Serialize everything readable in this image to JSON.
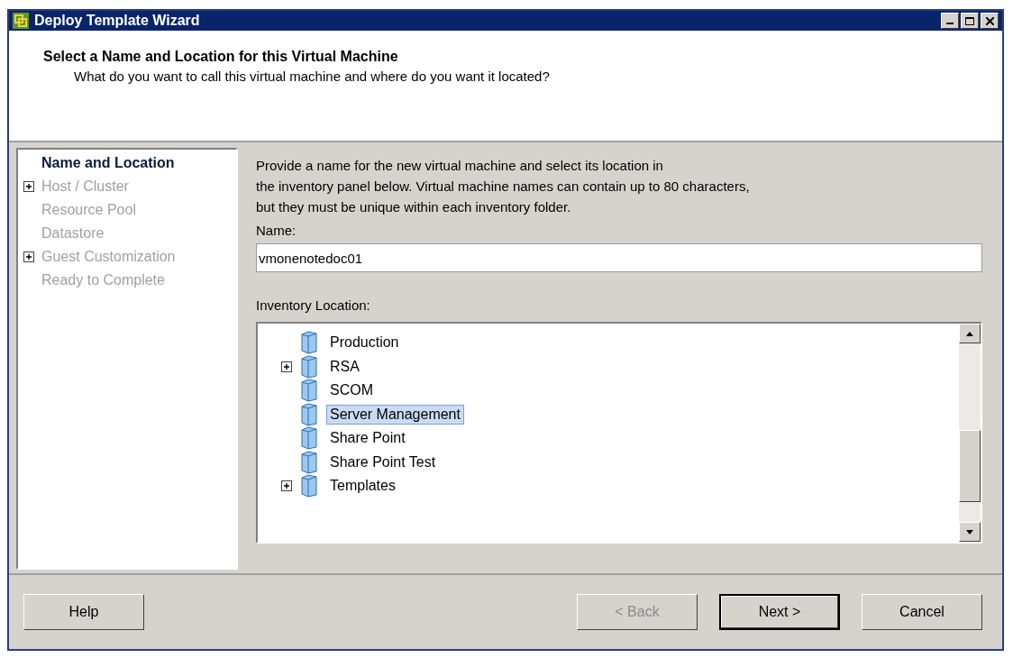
{
  "window": {
    "title": "Deploy Template Wizard"
  },
  "header": {
    "title": "Select a Name and Location for this Virtual Machine",
    "subtitle": "What do you want to call this virtual machine and where do you want it located?"
  },
  "steps": [
    {
      "label": "Name and Location",
      "current": true,
      "expandable": false
    },
    {
      "label": "Host / Cluster",
      "current": false,
      "expandable": true
    },
    {
      "label": "Resource Pool",
      "current": false,
      "expandable": false
    },
    {
      "label": "Datastore",
      "current": false,
      "expandable": false
    },
    {
      "label": "Guest Customization",
      "current": false,
      "expandable": true
    },
    {
      "label": "Ready to Complete",
      "current": false,
      "expandable": false
    }
  ],
  "description": [
    "Provide a name for the new virtual machine and select its location in",
    "the inventory panel below. Virtual  machine names can contain up to 80 characters,",
    "but they must be unique within each inventory folder."
  ],
  "name_field": {
    "label": "Name:",
    "value": "vmonenotedoc01"
  },
  "inventory": {
    "label": "Inventory Location:",
    "items": [
      {
        "label": "Production",
        "expandable": false,
        "selected": false
      },
      {
        "label": "RSA",
        "expandable": true,
        "selected": false
      },
      {
        "label": "SCOM",
        "expandable": false,
        "selected": false
      },
      {
        "label": "Server Management",
        "expandable": false,
        "selected": true
      },
      {
        "label": "Share Point",
        "expandable": false,
        "selected": false
      },
      {
        "label": "Share Point Test",
        "expandable": false,
        "selected": false
      },
      {
        "label": "Templates",
        "expandable": true,
        "selected": false
      }
    ]
  },
  "buttons": [
    {
      "label": "Help",
      "disabled": false,
      "default": false
    },
    {
      "label": "< Back",
      "disabled": true,
      "default": false
    },
    {
      "label": "Next >",
      "disabled": false,
      "default": true
    },
    {
      "label": "Cancel",
      "disabled": false,
      "default": false
    }
  ]
}
